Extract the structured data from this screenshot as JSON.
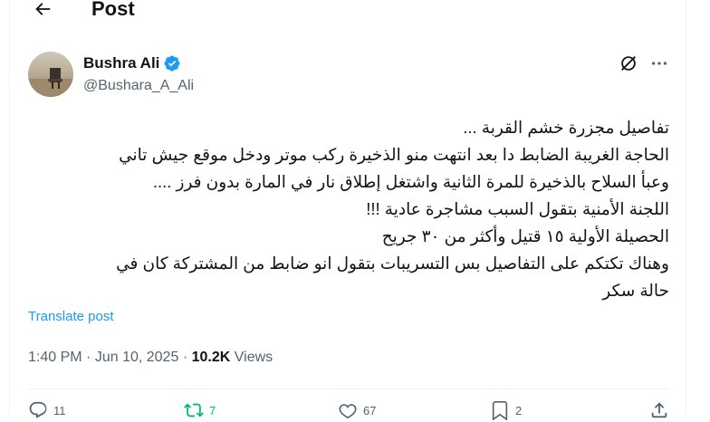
{
  "header": {
    "title": "Post",
    "back_icon": "arrow-left-icon"
  },
  "author": {
    "name": "Bushra Ali",
    "handle": "@Bushara_A_Ali",
    "verified_color": "#1d9bf0"
  },
  "tweet": {
    "text": "تفاصيل مجزرة خشم القربة ...\nالحاجة الغريبة الضابط دا بعد انتهت منو الذخيرة ركب موتر ودخل موقع جيش تاني\nوعبأ السلاح بالذخيرة للمرة الثانية واشتغل إطلاق نار في المارة بدون فرز ....\nاللجنة الأمنية بتقول السبب مشاجرة عادية !!!\nالحصيلة الأولية ١٥ قتيل وأكثر من ٣٠ جريح\nوهناك تكتكم على التفاصيل بس التسريبات بتقول انو ضابط من المشتركة كان في\nحالة سكر",
    "translate_label": "Translate post",
    "time": "1:40 PM",
    "date": "Jun 10, 2025",
    "views_count": "10.2K",
    "views_label": "Views"
  },
  "actions": {
    "replies": "11",
    "reposts": "7",
    "likes": "67",
    "bookmarks": "2",
    "repost_color": "#00ba7c",
    "icons": [
      "reply-icon",
      "repost-icon",
      "like-icon",
      "bookmark-icon",
      "share-icon"
    ]
  }
}
